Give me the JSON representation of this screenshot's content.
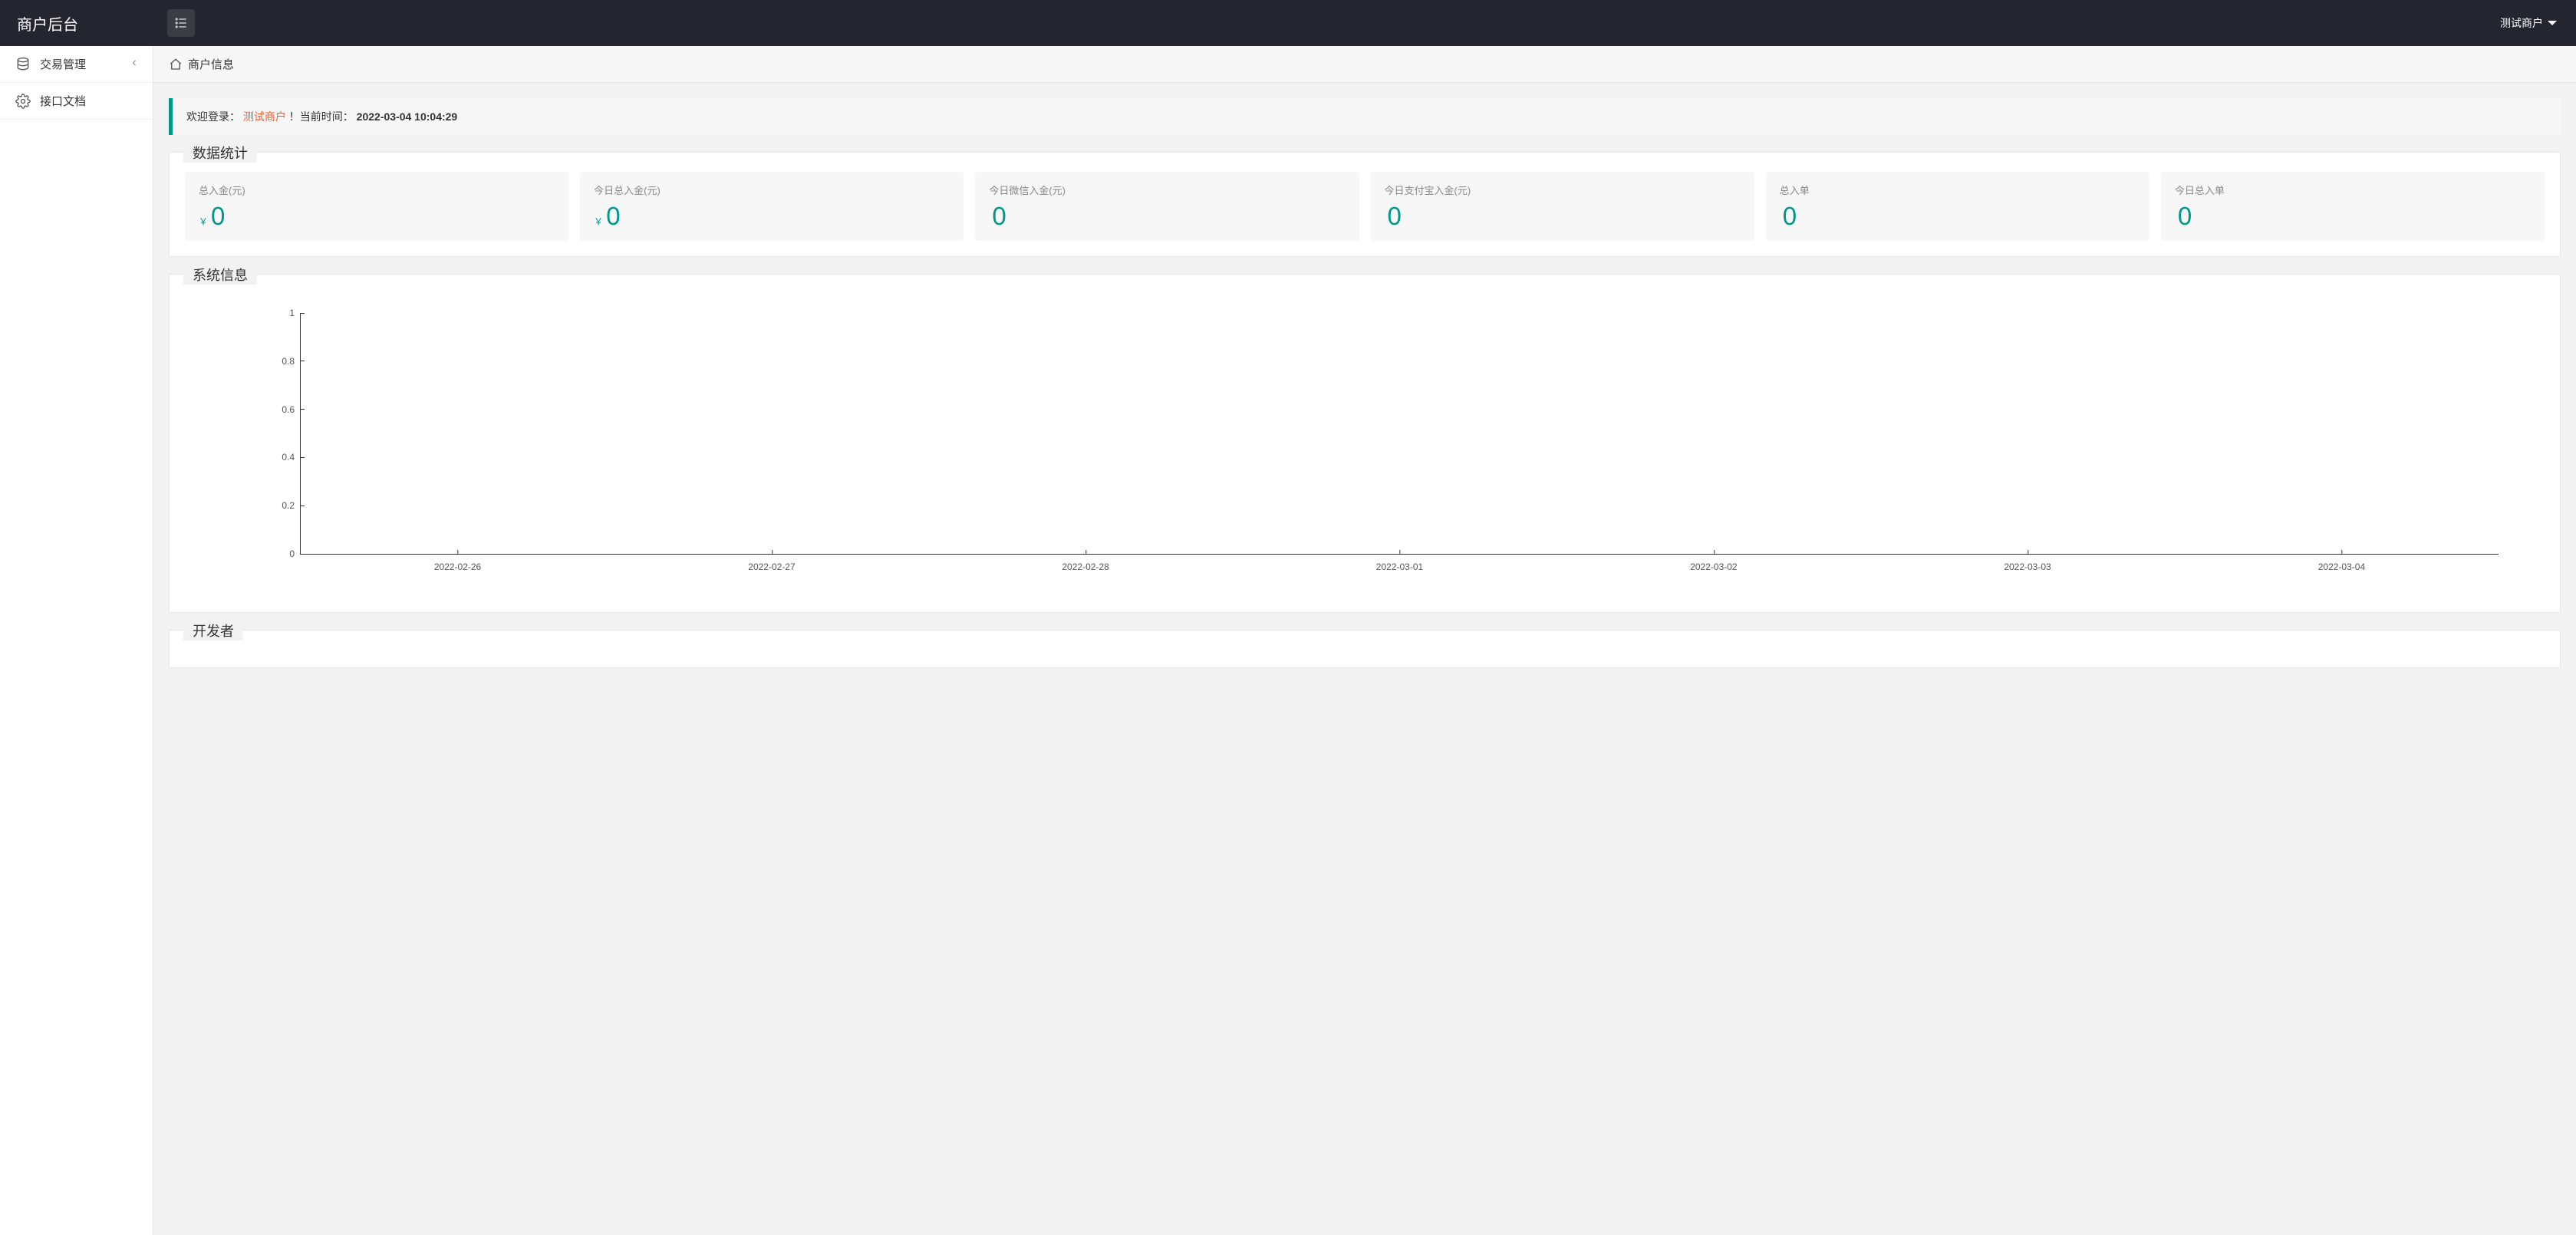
{
  "header": {
    "logo": "商户后台",
    "user": "测试商户"
  },
  "sidebar": {
    "items": [
      {
        "label": "交易管理",
        "icon": "database",
        "expandable": true
      },
      {
        "label": "接口文档",
        "icon": "gear",
        "expandable": false
      }
    ]
  },
  "breadcrumb": {
    "title": "商户信息"
  },
  "welcome": {
    "prefix": "欢迎登录：",
    "merchant": "测试商户",
    "suffix": "！当前时间：",
    "time": "2022-03-04 10:04:29"
  },
  "sections": {
    "stats_title": "数据统计",
    "system_title": "系统信息",
    "developer_title": "开发者"
  },
  "stats": [
    {
      "label": "总入金(元)",
      "value": "0",
      "prefix": "￥"
    },
    {
      "label": "今日总入金(元)",
      "value": "0",
      "prefix": "￥"
    },
    {
      "label": "今日微信入金(元)",
      "value": "0",
      "prefix": ""
    },
    {
      "label": "今日支付宝入金(元)",
      "value": "0",
      "prefix": ""
    },
    {
      "label": "总入单",
      "value": "0",
      "prefix": ""
    },
    {
      "label": "今日总入单",
      "value": "0",
      "prefix": ""
    }
  ],
  "chart_data": {
    "type": "line",
    "title": "",
    "xlabel": "",
    "ylabel": "",
    "ylim": [
      0,
      1
    ],
    "y_ticks": [
      "0",
      "0.2",
      "0.4",
      "0.6",
      "0.8",
      "1"
    ],
    "categories": [
      "2022-02-26",
      "2022-02-27",
      "2022-02-28",
      "2022-03-01",
      "2022-03-02",
      "2022-03-03",
      "2022-03-04"
    ],
    "series": [
      {
        "name": "",
        "values": [
          0,
          0,
          0,
          0,
          0,
          0,
          0
        ]
      }
    ]
  }
}
